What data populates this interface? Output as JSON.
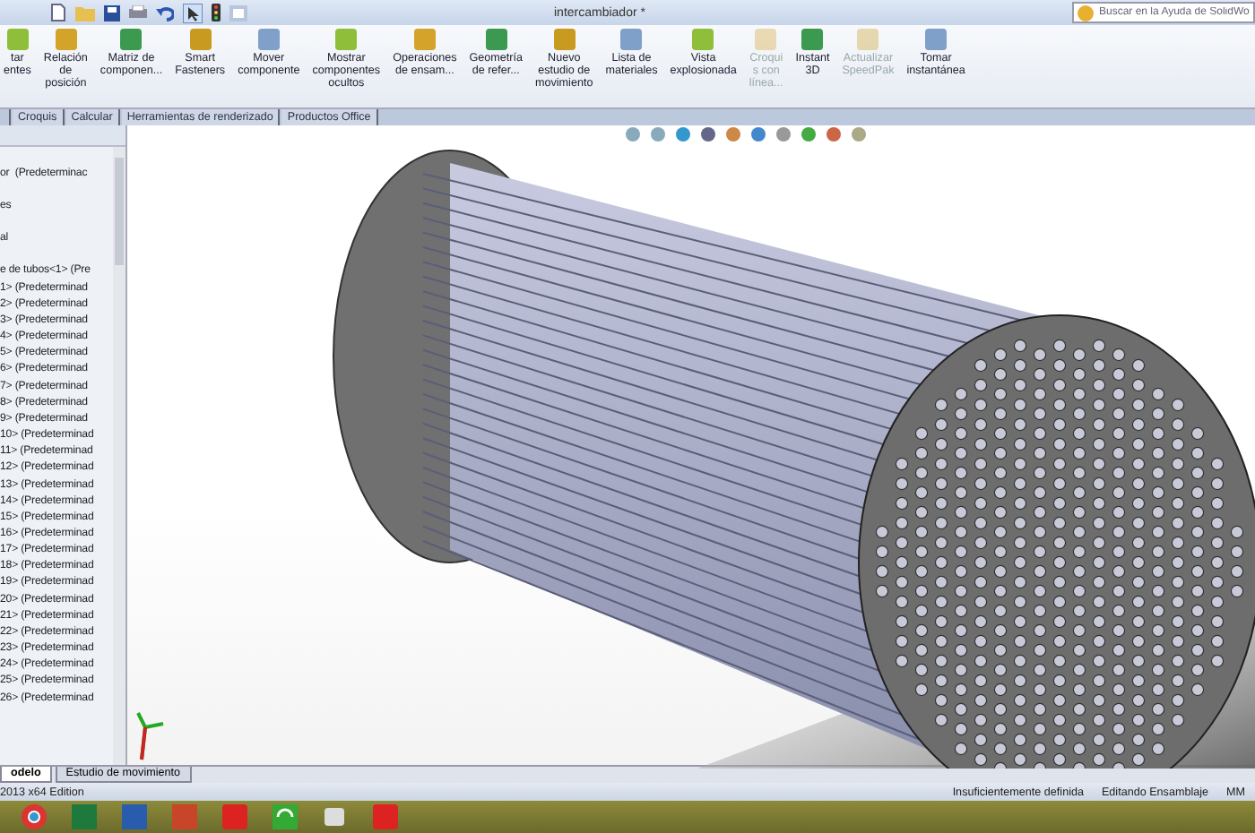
{
  "window": {
    "title": "intercambiador *"
  },
  "search": {
    "placeholder": "Buscar en la Ayuda de SolidWo"
  },
  "ribbon": [
    {
      "label": "tar\nentes",
      "disabled": false
    },
    {
      "label": "Relación\nde\nposición",
      "disabled": false
    },
    {
      "label": "Matriz de\ncomponen...",
      "disabled": false
    },
    {
      "label": "Smart\nFasteners",
      "disabled": false
    },
    {
      "label": "Mover\ncomponente",
      "disabled": false
    },
    {
      "label": "Mostrar\ncomponentes\nocultos",
      "disabled": false
    },
    {
      "label": "Operaciones\nde ensam...",
      "disabled": false
    },
    {
      "label": "Geometría\nde refer...",
      "disabled": false
    },
    {
      "label": "Nuevo\nestudio de\nmovimiento",
      "disabled": false
    },
    {
      "label": "Lista de\nmateriales",
      "disabled": false
    },
    {
      "label": "Vista\nexplosionada",
      "disabled": false
    },
    {
      "label": "Croqui\ns con\nlínea...",
      "disabled": true
    },
    {
      "label": "Instant\n3D",
      "disabled": false
    },
    {
      "label": "Actualizar\nSpeedPak",
      "disabled": true
    },
    {
      "label": "Tomar\ninstantánea",
      "disabled": false
    }
  ],
  "tabs": [
    {
      "label": "Croquis",
      "selected": false
    },
    {
      "label": "Calcular",
      "selected": false
    },
    {
      "label": "Herramientas de renderizado",
      "selected": false
    },
    {
      "label": "Productos Office",
      "selected": false
    }
  ],
  "tree": {
    "items": [
      "or  (Predeterminac",
      "es",
      "al",
      "e de tubos<1> (Pre",
      "1> (Predeterminad",
      "2> (Predeterminad",
      "3> (Predeterminad",
      "4> (Predeterminad",
      "5> (Predeterminad",
      "6> (Predeterminad",
      "7> (Predeterminad",
      "8> (Predeterminad",
      "9> (Predeterminad",
      "10> (Predeterminad",
      "11> (Predeterminad",
      "12> (Predeterminad",
      "13> (Predeterminad",
      "14> (Predeterminad",
      "15> (Predeterminad",
      "16> (Predeterminad",
      "17> (Predeterminad",
      "18> (Predeterminad",
      "19> (Predeterminad",
      "20> (Predeterminad",
      "21> (Predeterminad",
      "22> (Predeterminad",
      "23> (Predeterminad",
      "24> (Predeterminad",
      "25> (Predeterminad",
      "26> (Predeterminad"
    ]
  },
  "bottom_tabs": [
    {
      "label": "odelo",
      "selected": true
    },
    {
      "label": "Estudio de movimiento",
      "selected": false
    }
  ],
  "status_bar": {
    "edition": "2013 x64 Edition",
    "definition": "Insuficientemente definida",
    "mode": "Editando Ensamblaje",
    "units": "MM"
  }
}
